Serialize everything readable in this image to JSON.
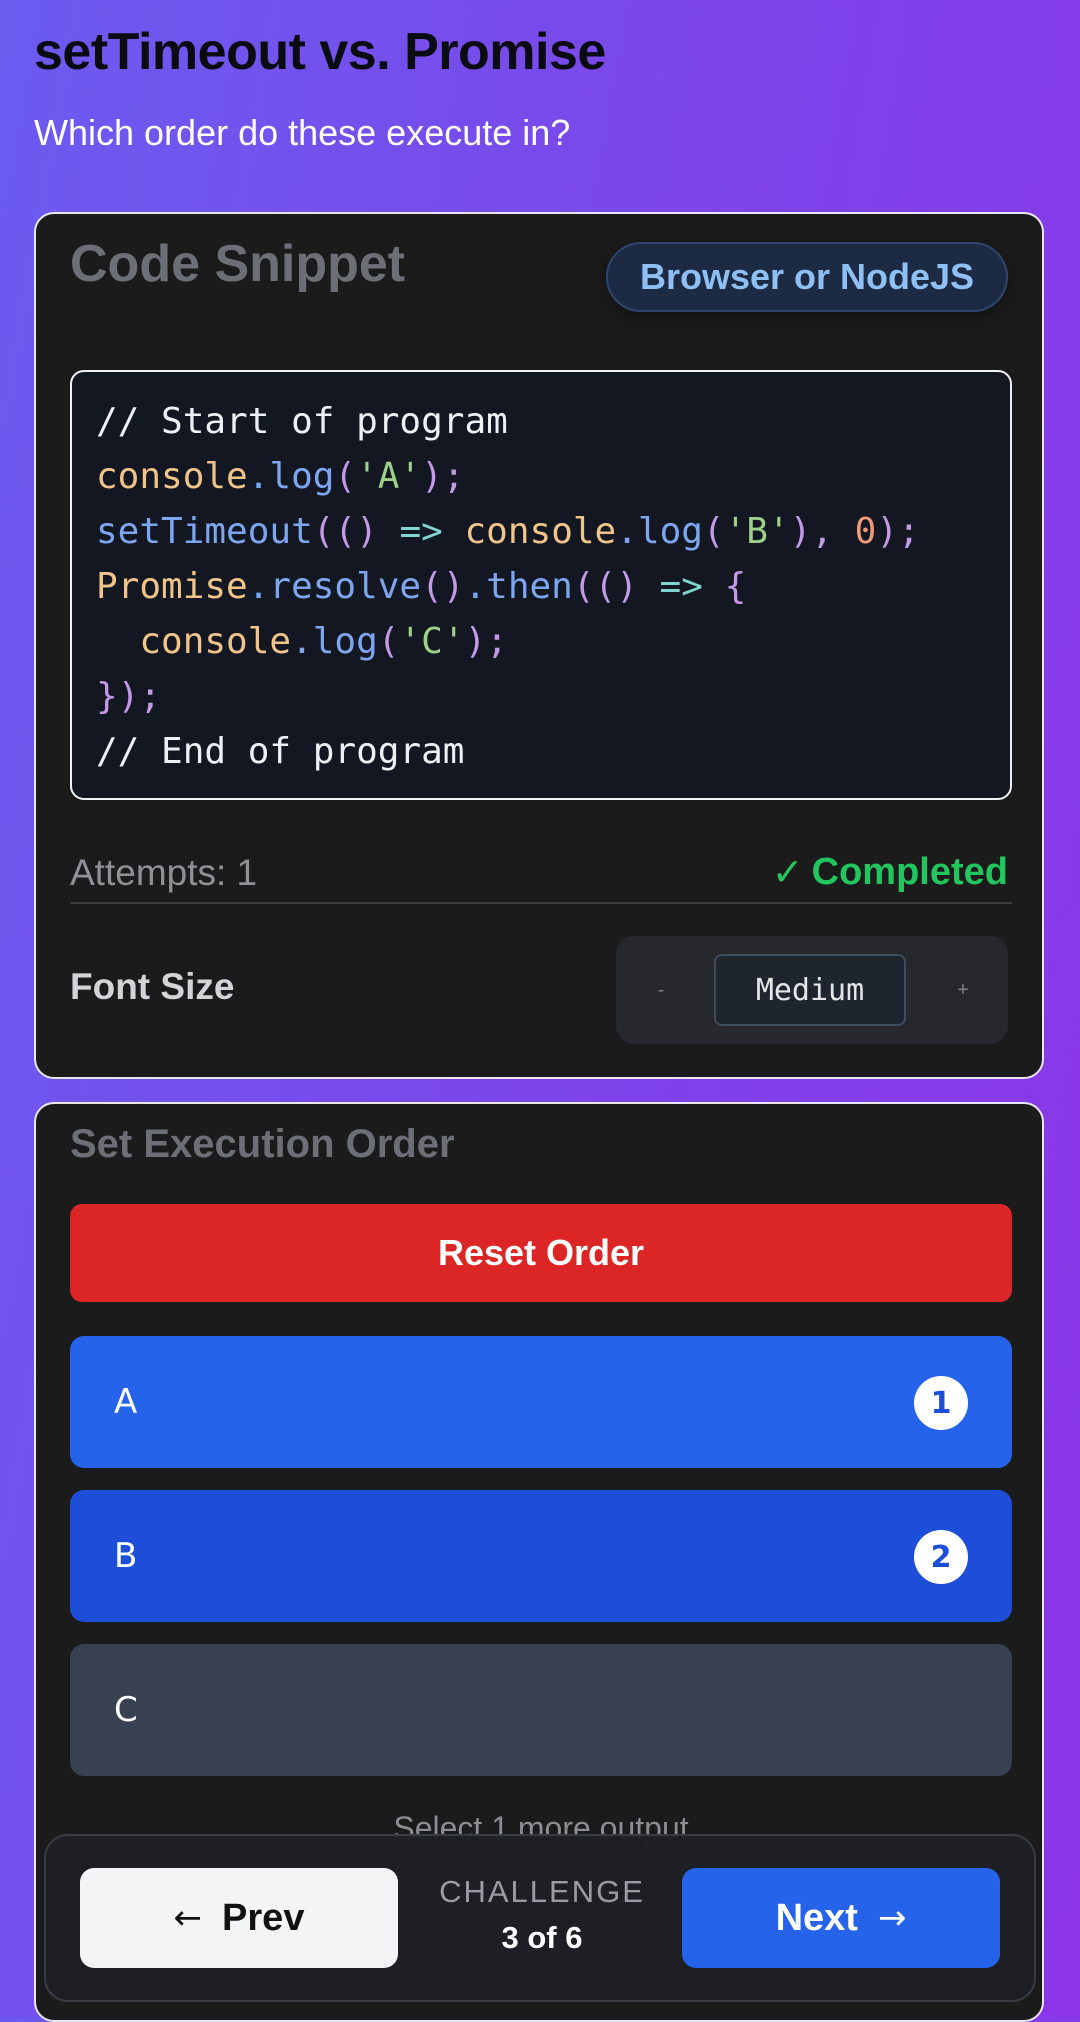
{
  "page": {
    "title": "setTimeout vs. Promise",
    "subtitle": "Which order do these execute in?"
  },
  "code_card": {
    "title": "Code Snippet",
    "env_badge": "Browser or NodeJS",
    "code_lines": [
      "// Start of program",
      "console.log('A');",
      "setTimeout(() => console.log('B'), 0);",
      "Promise.resolve().then(() => {",
      "  console.log('C');",
      "});",
      "// End of program"
    ],
    "attempts": "Attempts: 1",
    "status_icon": "check-icon",
    "status_text": "Completed",
    "font_size_label": "Font Size",
    "font_size_minus": "-",
    "font_size_value": "Medium",
    "font_size_plus": "+"
  },
  "order_card": {
    "title": "Set Execution Order",
    "reset_label": "Reset Order",
    "options": [
      {
        "label": "A",
        "order": "1"
      },
      {
        "label": "B",
        "order": "2"
      },
      {
        "label": "C",
        "order": ""
      }
    ],
    "hint": "Select 1 more output"
  },
  "nav": {
    "prev_label": "Prev",
    "next_label": "Next",
    "challenge_label": "CHALLENGE",
    "challenge_count": "3 of 6"
  },
  "colors": {
    "accent_blue": "#2563eb",
    "selected_blue": "#1d4ed8",
    "danger_red": "#dc2626",
    "success_green": "#22c55e"
  }
}
